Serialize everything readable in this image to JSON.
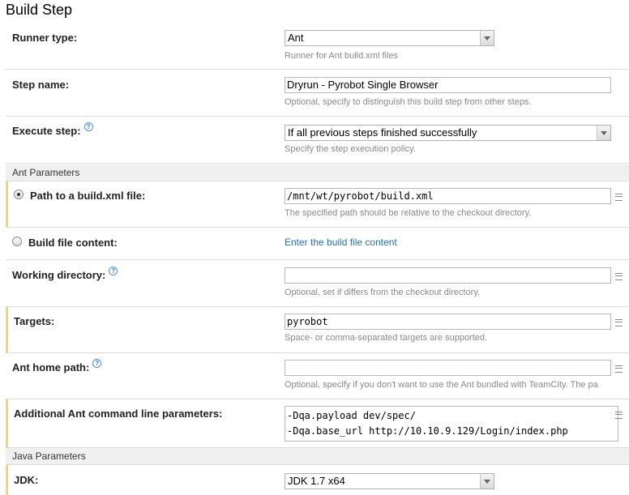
{
  "page": {
    "title": "Build Step"
  },
  "runner_type": {
    "label": "Runner type:",
    "value": "Ant",
    "note": "Runner for Ant build.xml files"
  },
  "step_name": {
    "label": "Step name:",
    "value": "Dryrun - Pyrobot Single Browser",
    "note": "Optional, specify to distinguish this build step from other steps."
  },
  "execute_step": {
    "label": "Execute step:",
    "value": "If all previous steps finished successfully",
    "note": "Specify the step execution policy."
  },
  "ant_parameters": {
    "header": "Ant Parameters",
    "path_option": {
      "label": "Path to a build.xml file:",
      "value": "/mnt/wt/pyrobot/build.xml",
      "note": "The specified path should be relative to the checkout directory.",
      "selected": true
    },
    "content_option": {
      "label": "Build file content:",
      "link": "Enter the build file content",
      "selected": false
    },
    "working_directory": {
      "label": "Working directory:",
      "value": "",
      "note": "Optional, set if differs from the checkout directory."
    },
    "targets": {
      "label": "Targets:",
      "value": "pyrobot",
      "note": "Space- or comma-separated targets are supported."
    },
    "ant_home": {
      "label": "Ant home path:",
      "value": "",
      "note": "Optional, specify if you don't want to use the Ant bundled with TeamCity. The pa"
    },
    "cmd_params": {
      "label": "Additional Ant command line parameters:",
      "lines": [
        "-Dqa.payload dev/spec/",
        "-Dqa.base_url http://10.10.9.129/Login/index.php"
      ]
    }
  },
  "java_parameters": {
    "header": "Java Parameters",
    "jdk": {
      "label": "JDK:",
      "value": "JDK 1.7 x64"
    }
  },
  "icons": {
    "help": "help-icon",
    "edit": "edit-field-icon",
    "dropdown": "chevron-down-icon",
    "radio": "radio-icon"
  },
  "colors": {
    "highlight_border": "#f5d76e",
    "link": "#2a6ebb",
    "note": "#8a8a8a",
    "group_bg": "#f0f0f0"
  }
}
